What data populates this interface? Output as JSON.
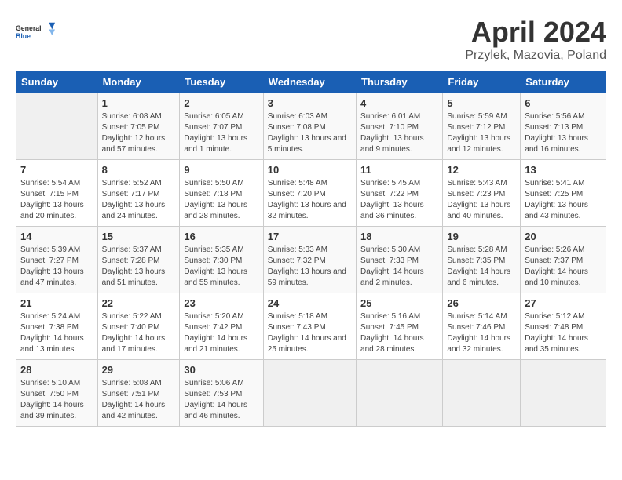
{
  "logo": {
    "general": "General",
    "blue": "Blue"
  },
  "title": "April 2024",
  "subtitle": "Przylek, Mazovia, Poland",
  "days_of_week": [
    "Sunday",
    "Monday",
    "Tuesday",
    "Wednesday",
    "Thursday",
    "Friday",
    "Saturday"
  ],
  "weeks": [
    [
      {
        "day": "",
        "sunrise": "",
        "sunset": "",
        "daylight": "",
        "empty": true
      },
      {
        "day": "1",
        "sunrise": "Sunrise: 6:08 AM",
        "sunset": "Sunset: 7:05 PM",
        "daylight": "Daylight: 12 hours and 57 minutes."
      },
      {
        "day": "2",
        "sunrise": "Sunrise: 6:05 AM",
        "sunset": "Sunset: 7:07 PM",
        "daylight": "Daylight: 13 hours and 1 minute."
      },
      {
        "day": "3",
        "sunrise": "Sunrise: 6:03 AM",
        "sunset": "Sunset: 7:08 PM",
        "daylight": "Daylight: 13 hours and 5 minutes."
      },
      {
        "day": "4",
        "sunrise": "Sunrise: 6:01 AM",
        "sunset": "Sunset: 7:10 PM",
        "daylight": "Daylight: 13 hours and 9 minutes."
      },
      {
        "day": "5",
        "sunrise": "Sunrise: 5:59 AM",
        "sunset": "Sunset: 7:12 PM",
        "daylight": "Daylight: 13 hours and 12 minutes."
      },
      {
        "day": "6",
        "sunrise": "Sunrise: 5:56 AM",
        "sunset": "Sunset: 7:13 PM",
        "daylight": "Daylight: 13 hours and 16 minutes."
      }
    ],
    [
      {
        "day": "7",
        "sunrise": "Sunrise: 5:54 AM",
        "sunset": "Sunset: 7:15 PM",
        "daylight": "Daylight: 13 hours and 20 minutes."
      },
      {
        "day": "8",
        "sunrise": "Sunrise: 5:52 AM",
        "sunset": "Sunset: 7:17 PM",
        "daylight": "Daylight: 13 hours and 24 minutes."
      },
      {
        "day": "9",
        "sunrise": "Sunrise: 5:50 AM",
        "sunset": "Sunset: 7:18 PM",
        "daylight": "Daylight: 13 hours and 28 minutes."
      },
      {
        "day": "10",
        "sunrise": "Sunrise: 5:48 AM",
        "sunset": "Sunset: 7:20 PM",
        "daylight": "Daylight: 13 hours and 32 minutes."
      },
      {
        "day": "11",
        "sunrise": "Sunrise: 5:45 AM",
        "sunset": "Sunset: 7:22 PM",
        "daylight": "Daylight: 13 hours and 36 minutes."
      },
      {
        "day": "12",
        "sunrise": "Sunrise: 5:43 AM",
        "sunset": "Sunset: 7:23 PM",
        "daylight": "Daylight: 13 hours and 40 minutes."
      },
      {
        "day": "13",
        "sunrise": "Sunrise: 5:41 AM",
        "sunset": "Sunset: 7:25 PM",
        "daylight": "Daylight: 13 hours and 43 minutes."
      }
    ],
    [
      {
        "day": "14",
        "sunrise": "Sunrise: 5:39 AM",
        "sunset": "Sunset: 7:27 PM",
        "daylight": "Daylight: 13 hours and 47 minutes."
      },
      {
        "day": "15",
        "sunrise": "Sunrise: 5:37 AM",
        "sunset": "Sunset: 7:28 PM",
        "daylight": "Daylight: 13 hours and 51 minutes."
      },
      {
        "day": "16",
        "sunrise": "Sunrise: 5:35 AM",
        "sunset": "Sunset: 7:30 PM",
        "daylight": "Daylight: 13 hours and 55 minutes."
      },
      {
        "day": "17",
        "sunrise": "Sunrise: 5:33 AM",
        "sunset": "Sunset: 7:32 PM",
        "daylight": "Daylight: 13 hours and 59 minutes."
      },
      {
        "day": "18",
        "sunrise": "Sunrise: 5:30 AM",
        "sunset": "Sunset: 7:33 PM",
        "daylight": "Daylight: 14 hours and 2 minutes."
      },
      {
        "day": "19",
        "sunrise": "Sunrise: 5:28 AM",
        "sunset": "Sunset: 7:35 PM",
        "daylight": "Daylight: 14 hours and 6 minutes."
      },
      {
        "day": "20",
        "sunrise": "Sunrise: 5:26 AM",
        "sunset": "Sunset: 7:37 PM",
        "daylight": "Daylight: 14 hours and 10 minutes."
      }
    ],
    [
      {
        "day": "21",
        "sunrise": "Sunrise: 5:24 AM",
        "sunset": "Sunset: 7:38 PM",
        "daylight": "Daylight: 14 hours and 13 minutes."
      },
      {
        "day": "22",
        "sunrise": "Sunrise: 5:22 AM",
        "sunset": "Sunset: 7:40 PM",
        "daylight": "Daylight: 14 hours and 17 minutes."
      },
      {
        "day": "23",
        "sunrise": "Sunrise: 5:20 AM",
        "sunset": "Sunset: 7:42 PM",
        "daylight": "Daylight: 14 hours and 21 minutes."
      },
      {
        "day": "24",
        "sunrise": "Sunrise: 5:18 AM",
        "sunset": "Sunset: 7:43 PM",
        "daylight": "Daylight: 14 hours and 25 minutes."
      },
      {
        "day": "25",
        "sunrise": "Sunrise: 5:16 AM",
        "sunset": "Sunset: 7:45 PM",
        "daylight": "Daylight: 14 hours and 28 minutes."
      },
      {
        "day": "26",
        "sunrise": "Sunrise: 5:14 AM",
        "sunset": "Sunset: 7:46 PM",
        "daylight": "Daylight: 14 hours and 32 minutes."
      },
      {
        "day": "27",
        "sunrise": "Sunrise: 5:12 AM",
        "sunset": "Sunset: 7:48 PM",
        "daylight": "Daylight: 14 hours and 35 minutes."
      }
    ],
    [
      {
        "day": "28",
        "sunrise": "Sunrise: 5:10 AM",
        "sunset": "Sunset: 7:50 PM",
        "daylight": "Daylight: 14 hours and 39 minutes."
      },
      {
        "day": "29",
        "sunrise": "Sunrise: 5:08 AM",
        "sunset": "Sunset: 7:51 PM",
        "daylight": "Daylight: 14 hours and 42 minutes."
      },
      {
        "day": "30",
        "sunrise": "Sunrise: 5:06 AM",
        "sunset": "Sunset: 7:53 PM",
        "daylight": "Daylight: 14 hours and 46 minutes."
      },
      {
        "day": "",
        "sunrise": "",
        "sunset": "",
        "daylight": "",
        "empty": true
      },
      {
        "day": "",
        "sunrise": "",
        "sunset": "",
        "daylight": "",
        "empty": true
      },
      {
        "day": "",
        "sunrise": "",
        "sunset": "",
        "daylight": "",
        "empty": true
      },
      {
        "day": "",
        "sunrise": "",
        "sunset": "",
        "daylight": "",
        "empty": true
      }
    ]
  ]
}
